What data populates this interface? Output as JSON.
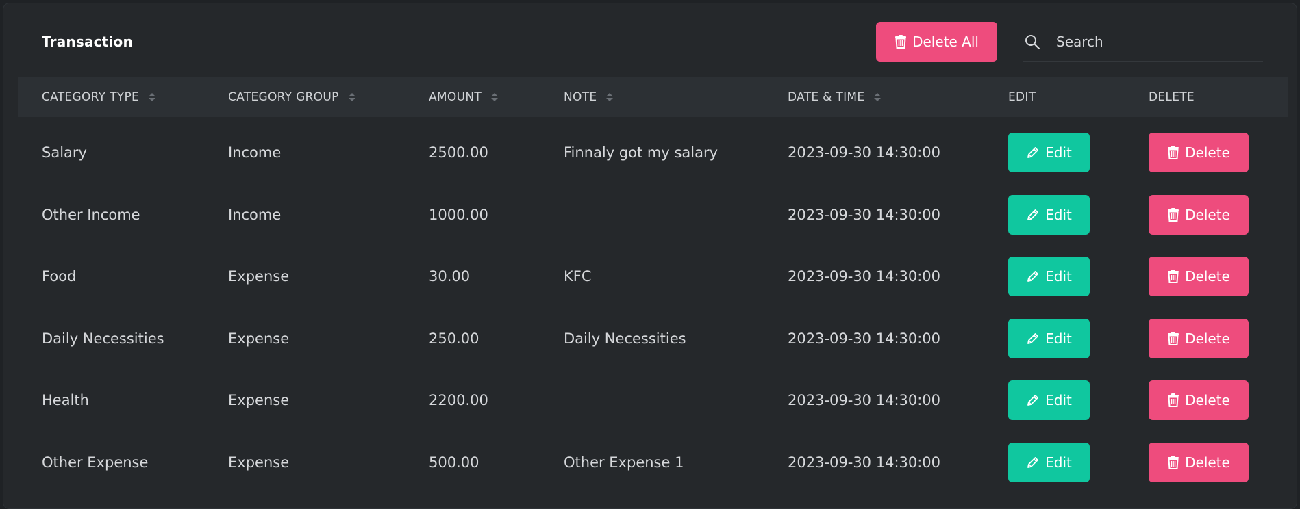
{
  "title": "Transaction",
  "toolbar": {
    "delete_all_label": "Delete All",
    "search_placeholder": "Search",
    "search_value": ""
  },
  "columns": [
    {
      "label": "CATEGORY TYPE",
      "sortable": true
    },
    {
      "label": "CATEGORY GROUP",
      "sortable": true
    },
    {
      "label": "AMOUNT",
      "sortable": true
    },
    {
      "label": "NOTE",
      "sortable": true
    },
    {
      "label": "DATE & TIME",
      "sortable": true
    },
    {
      "label": "EDIT",
      "sortable": false
    },
    {
      "label": "DELETE",
      "sortable": false
    }
  ],
  "action_labels": {
    "edit": "Edit",
    "delete": "Delete"
  },
  "rows": [
    {
      "category_type": "Salary",
      "category_group": "Income",
      "amount": "2500.00",
      "note": "Finnaly got my salary",
      "datetime": "2023-09-30 14:30:00"
    },
    {
      "category_type": "Other Income",
      "category_group": "Income",
      "amount": "1000.00",
      "note": "",
      "datetime": "2023-09-30 14:30:00"
    },
    {
      "category_type": "Food",
      "category_group": "Expense",
      "amount": "30.00",
      "note": "KFC",
      "datetime": "2023-09-30 14:30:00"
    },
    {
      "category_type": "Daily Necessities",
      "category_group": "Expense",
      "amount": "250.00",
      "note": "Daily Necessities",
      "datetime": "2023-09-30 14:30:00"
    },
    {
      "category_type": "Health",
      "category_group": "Expense",
      "amount": "2200.00",
      "note": "",
      "datetime": "2023-09-30 14:30:00"
    },
    {
      "category_type": "Other Expense",
      "category_group": "Expense",
      "amount": "500.00",
      "note": "Other Expense 1",
      "datetime": "2023-09-30 14:30:00"
    }
  ],
  "colors": {
    "background": "#1f2225",
    "card": "#25282b",
    "header": "#2c3034",
    "danger": "#ee4c7d",
    "success": "#10c79f"
  },
  "icons": {
    "delete_all": "trash-icon",
    "search": "search-icon",
    "sort": "sort-icon",
    "edit": "pencil-icon",
    "delete": "trash-icon"
  }
}
